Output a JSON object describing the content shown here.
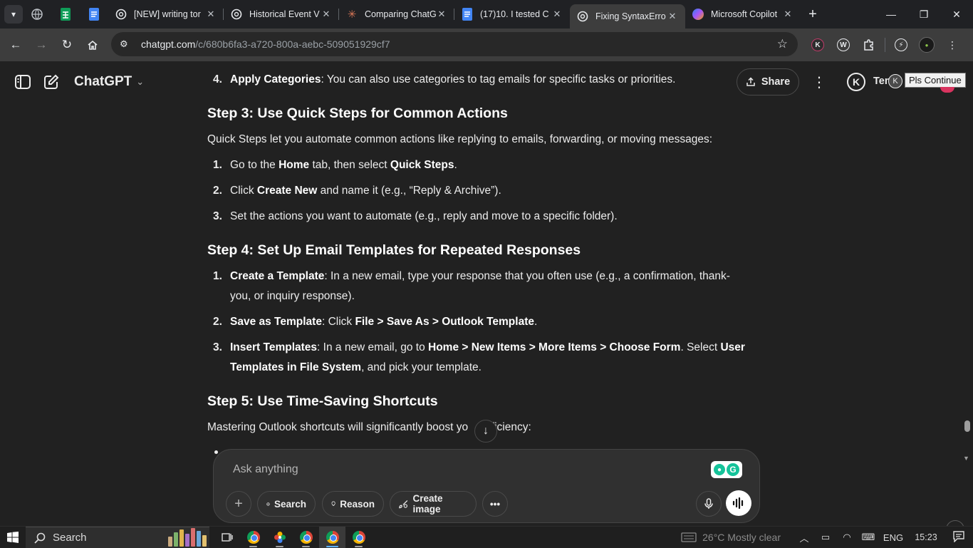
{
  "browser": {
    "tabs": [
      {
        "title": "[NEW] writing tor",
        "icon": "openai-icon"
      },
      {
        "title": "Historical Event V",
        "icon": "openai-icon"
      },
      {
        "title": "Comparing ChatG",
        "icon": "claude-icon"
      },
      {
        "title": "(17)10. I tested C",
        "icon": "docs-icon"
      },
      {
        "title": "Fixing SyntaxErro",
        "icon": "openai-icon",
        "active": true
      },
      {
        "title": "Microsoft Copilot",
        "icon": "copilot-icon"
      }
    ],
    "url_host": "chatgpt.com",
    "url_path": "/c/680b6fa3-a720-800a-aebc-509051929cf7"
  },
  "header": {
    "model": "ChatGPT",
    "share_label": "Share",
    "ext_letter": "K",
    "user_text": "Ten",
    "tooltip": "Pls Continue"
  },
  "content": {
    "item_top": {
      "num": "4.",
      "bold": "Apply Categories",
      "rest": ": You can also use categories to tag emails for specific tasks or priorities."
    },
    "step3": {
      "heading": "Step 3: Use Quick Steps for Common Actions",
      "intro": "Quick Steps let you automate common actions like replying to emails, forwarding, or moving messages:",
      "i1_num": "1.",
      "i1_a": "Go to the ",
      "i1_b": "Home",
      "i1_c": " tab, then select ",
      "i1_d": "Quick Steps",
      "i1_e": ".",
      "i2_num": "2.",
      "i2_a": "Click ",
      "i2_b": "Create New",
      "i2_c": " and name it (e.g., “Reply & Archive”).",
      "i3_num": "3.",
      "i3_a": "Set the actions you want to automate (e.g., reply and move to a specific folder)."
    },
    "step4": {
      "heading": "Step 4: Set Up Email Templates for Repeated Responses",
      "i1_num": "1.",
      "i1_b": "Create a Template",
      "i1_c": ": In a new email, type your response that you often use (e.g., a confirmation, thank-you, or inquiry response).",
      "i2_num": "2.",
      "i2_b": "Save as Template",
      "i2_c": ": Click ",
      "i2_d": "File > Save As > Outlook Template",
      "i2_e": ".",
      "i3_num": "3.",
      "i3_b": "Insert Templates",
      "i3_c": ": In a new email, go to ",
      "i3_d": "Home > New Items > More Items > Choose Form",
      "i3_e": ". Select ",
      "i3_f": "User Templates in File System",
      "i3_g": ", and pick your template."
    },
    "step5": {
      "heading": "Step 5: Use Time-Saving Shortcuts",
      "intro_a": "Mastering Outlook shortcuts will significantly boost yo",
      "intro_b": "efficiency:"
    }
  },
  "composer": {
    "placeholder": "Ask anything",
    "search_label": "Search",
    "reason_label": "Reason",
    "image_label": "Create image"
  },
  "taskbar": {
    "search_label": "Search",
    "weather": "26°C  Mostly clear",
    "lang": "ENG",
    "time": "15:23"
  }
}
